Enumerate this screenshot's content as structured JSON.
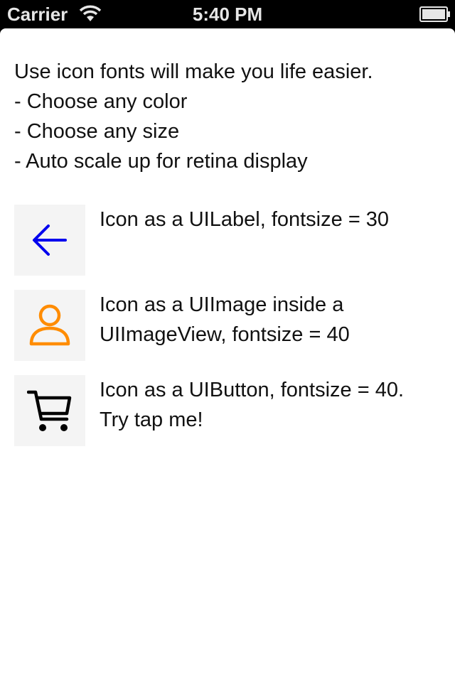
{
  "status_bar": {
    "carrier": "Carrier",
    "time": "5:40 PM",
    "wifi_icon": "wifi-icon",
    "battery_icon": "battery-icon"
  },
  "intro": {
    "lines": [
      "Use icon fonts will make you life easier.",
      "- Choose any color",
      "- Choose any size",
      "- Auto scale up for retina display"
    ]
  },
  "rows": [
    {
      "icon": "arrow-left-icon",
      "icon_color": "#0000ee",
      "lines": [
        "Icon as a UILabel, fontsize = 30"
      ]
    },
    {
      "icon": "user-icon",
      "icon_color": "#ff8c00",
      "lines": [
        "Icon as a UIImage inside a",
        "UIImageView, fontsize = 40"
      ]
    },
    {
      "icon": "shopping-cart-icon",
      "icon_color": "#000000",
      "lines": [
        "Icon as a UIButton, fontsize = 40.",
        "Try tap me!"
      ]
    }
  ]
}
